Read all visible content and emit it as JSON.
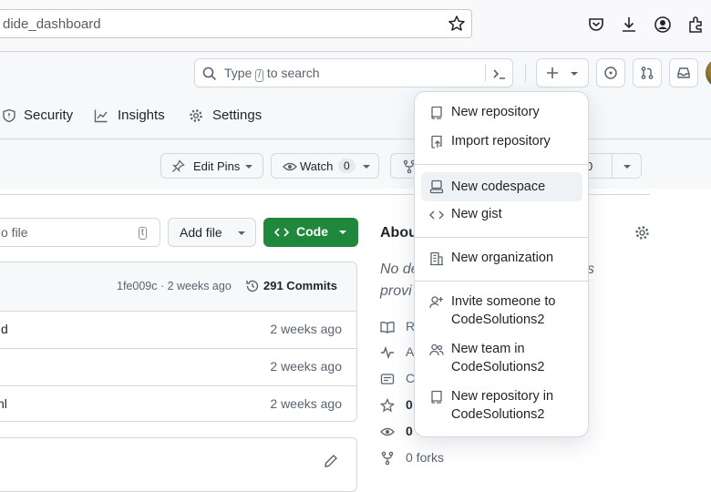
{
  "browser": {
    "url": "dide_dashboard"
  },
  "header": {
    "search_prefix": "Type",
    "search_key": "/",
    "search_suffix": "to search"
  },
  "repo_nav": {
    "security": "Security",
    "insights": "Insights",
    "settings": "Settings"
  },
  "repo_actions": {
    "edit_pins": "Edit Pins",
    "watch": "Watch",
    "watch_count": "0",
    "fork_count": "0"
  },
  "file_toolbar": {
    "goto_placeholder": "o file",
    "goto_key": "t",
    "add_file": "Add file",
    "code": "Code"
  },
  "latest_commit": {
    "hash": "1fe009c · 2 weeks ago",
    "commits": "291 Commits"
  },
  "files": [
    {
      "name": "d",
      "age": "2 weeks ago"
    },
    {
      "name": "",
      "age": "2 weeks ago"
    },
    {
      "name": "nl",
      "age": "2 weeks ago"
    }
  ],
  "about": {
    "title": "Abou",
    "desc_line1": "No de",
    "desc_line1_tail": "s",
    "desc_line2": "provi",
    "forks": "0 forks",
    "stars": "0",
    "watching": "0"
  },
  "menu": {
    "new_repository": "New repository",
    "import_repository": "Import repository",
    "new_codespace": "New codespace",
    "new_gist": "New gist",
    "new_organization": "New organization",
    "invite_line1": "Invite someone to",
    "invite_line2": "CodeSolutions2",
    "new_team_line1": "New team in",
    "new_team_line2": "CodeSolutions2",
    "new_repo_in_line1": "New repository in",
    "new_repo_in_line2": "CodeSolutions2"
  },
  "colors": {
    "accent_green": "#1f883d",
    "menu_highlight": "#eff2f5",
    "border": "#d1d9e0"
  }
}
